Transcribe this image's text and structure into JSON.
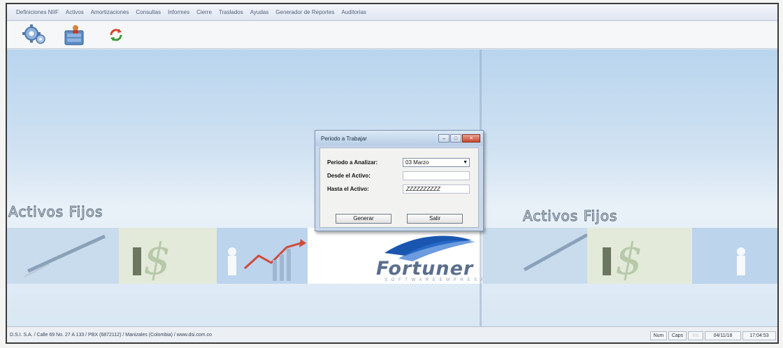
{
  "menu": [
    "Definiciones NIIF",
    "Activos",
    "Amortizaciones",
    "Consultas",
    "Informes",
    "Cierre",
    "Traslados",
    "Ayudas",
    "Generador de Reportes",
    "Auditorias"
  ],
  "toolbar": {
    "icons": [
      "settings-gear-icon",
      "cabinet-user-icon",
      "refresh-icon"
    ]
  },
  "banner": {
    "title_left": "Activos Fijos",
    "title_right": "Activos Fijos",
    "logo_word": "Fortuner",
    "logo_sub": "S O F T W A R E   E M P R E S A R I A L"
  },
  "dialog": {
    "title": "Periodo a Trabajar",
    "period_label": "Periodo a Analizar:",
    "period_value": "03 Marzo",
    "from_label": "Desde el Activo:",
    "from_value": "",
    "to_label": "Hasta el Activo:",
    "to_value": "ZZZZZZZZZZ",
    "generate_label": "Generar",
    "exit_label": "Salir"
  },
  "status": {
    "company": "D.S.I. S.A. / Calle 69 No. 27 A 133 / PBX (6872112) / Manizales (Colombia) / www.dsi.com.co",
    "num": "Num",
    "caps": "Caps",
    "ins": "Ins",
    "date": "04/11/18",
    "time": "17:04:53"
  },
  "colors": {
    "workspace_top": "#b9d5ee",
    "dialog_close": "#c8432c",
    "logo_accent": "#1a56b0"
  }
}
